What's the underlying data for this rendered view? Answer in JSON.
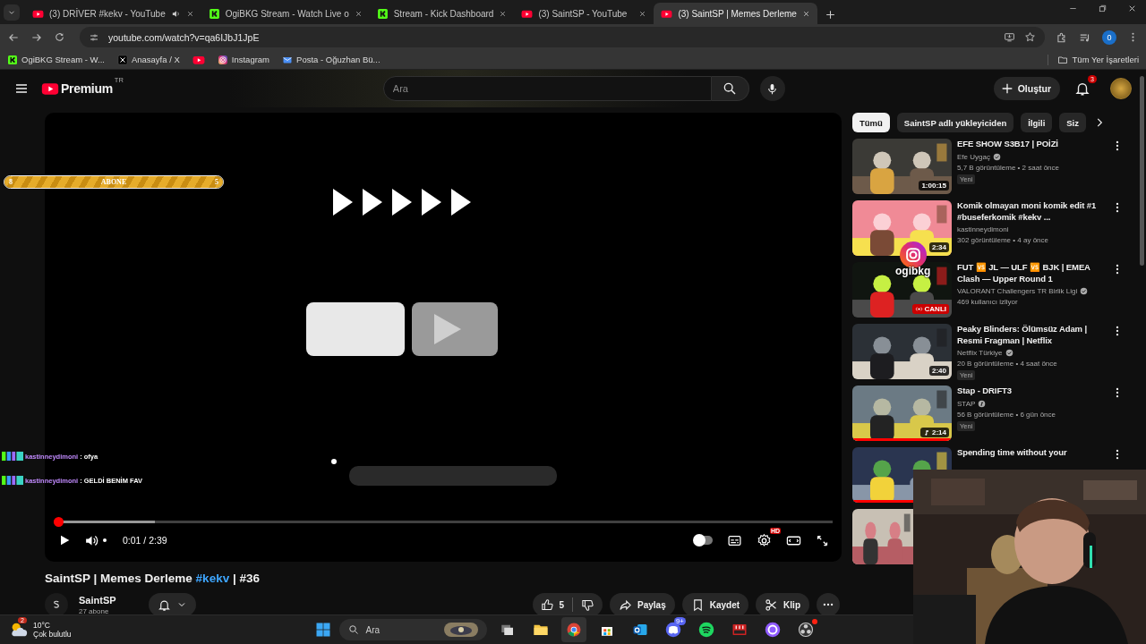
{
  "browser": {
    "tabs": [
      {
        "title": "(3) DRİVER #kekv - YouTube",
        "audio": true,
        "selected": false
      },
      {
        "title": "OgiBKG Stream - Watch Live o",
        "audio": false,
        "selected": false
      },
      {
        "title": "Stream - Kick Dashboard",
        "audio": false,
        "selected": false
      },
      {
        "title": "(3) SaintSP - YouTube",
        "audio": false,
        "selected": false
      },
      {
        "title": "(3) SaintSP | Memes Derleme",
        "audio": false,
        "selected": true
      }
    ],
    "address": "youtube.com/watch?v=qa6IJbJ1JpE",
    "bookmarks": [
      {
        "label": "OgiBKG Stream - W..."
      },
      {
        "label": "Anasayfa / X"
      },
      {
        "kind": "icon"
      },
      {
        "label": "Instagram"
      },
      {
        "label": "Posta - Oğuzhan Bü..."
      }
    ],
    "all_bookmarks": "Tüm Yer İşaretleri",
    "profile": "0"
  },
  "youtube": {
    "logo": "Premium",
    "region": "TR",
    "search_placeholder": "Ara",
    "create": "Oluştur",
    "notifications": "3",
    "player": {
      "time": "0:01 / 2:39",
      "progress": {
        "level": 0.006
      },
      "buffer": {
        "level": 0.13
      },
      "quality_badge": "HD",
      "autoplay": false
    },
    "title_parts": [
      {
        "text": "SaintSP | Memes Derleme ",
        "kind": "plain"
      },
      {
        "text": "#kekv",
        "kind": "hashtag"
      },
      {
        "text": " | #36",
        "kind": "plain"
      }
    ],
    "channel": {
      "name": "SaintSP",
      "subscribers": "27 abone"
    },
    "likes": "5",
    "actions": [
      {
        "label": "Paylaş",
        "kind": "share"
      },
      {
        "label": "Kaydet",
        "kind": "save"
      },
      {
        "label": "Klip",
        "kind": "clip"
      }
    ],
    "chips": [
      {
        "label": "Tümü",
        "selected": true
      },
      {
        "label": "SaintSP adlı yükleyiciden",
        "selected": false
      },
      {
        "label": "İlgili",
        "selected": false
      },
      {
        "label": "Siz",
        "selected": false
      }
    ],
    "recommendations": [
      {
        "title": "EFE SHOW S3B17 | POİZİ",
        "channel": "Efe Uygaç",
        "verified": true,
        "meta": "5,7 B görüntüleme • 2 saat önce",
        "tag": "Yeni",
        "duration": "1:00:15",
        "kind": "video"
      },
      {
        "title": "Komik olmayan moni komik edit #1 #buseferkomik #kekv ...",
        "channel": "kastinneydimoni",
        "verified": false,
        "meta": "302 görüntüleme • 4 ay önce",
        "duration": "2:34",
        "kind": "video"
      },
      {
        "title": "FUT 🆚 JL — ULF 🆚 BJK | EMEA Clash — Upper Round 1",
        "channel": "VALORANT Challengers TR Birlik Ligi",
        "verified": true,
        "meta": "469 kullanıcı izliyor",
        "duration": "CANLI",
        "kind": "live"
      },
      {
        "title": "Peaky Blinders: Ölümsüz Adam | Resmi Fragman | Netflix",
        "channel": "Netflix Türkiye",
        "verified": true,
        "meta": "20 B görüntüleme • 4 saat önce",
        "tag": "Yeni",
        "duration": "2:40",
        "kind": "video"
      },
      {
        "title": "Stap - DRIFT3",
        "channel": "STAP",
        "verified": true,
        "meta": "56 B görüntüleme • 6 gün önce",
        "tag": "Yeni",
        "duration": "2:14",
        "kind": "music",
        "watched": {
          "level": 1
        }
      },
      {
        "title": "Spending time without your",
        "watched": {
          "level": 1
        }
      },
      {
        "kind": "thumbnail"
      }
    ]
  },
  "overlay": {
    "goal": {
      "label": "ABONE",
      "start": "8",
      "end": "5",
      "level": 1
    },
    "chat": [
      {
        "user": "kastinneydimoni",
        "message": ": ofya"
      },
      {
        "user": "kastinneydimoni",
        "message": ": GELDİ BENİM FAV"
      }
    ],
    "social": {
      "handle": "ogibkg"
    }
  },
  "taskbar": {
    "weather": {
      "temperature": "10°C",
      "condition": "Çok bulutlu",
      "badge": "2"
    },
    "search_placeholder": "Ara",
    "apps": [
      {
        "kind": "taskview",
        "active": false,
        "alert": false
      },
      {
        "kind": "explorer",
        "active": false,
        "alert": false
      },
      {
        "kind": "browser",
        "active": true,
        "alert": false
      },
      {
        "kind": "store",
        "active": false,
        "alert": false
      },
      {
        "kind": "mail",
        "active": false,
        "alert": false
      },
      {
        "kind": "chat",
        "active": false,
        "alert": false,
        "badge": "9+"
      },
      {
        "kind": "music",
        "active": false,
        "alert": false
      },
      {
        "kind": "mixer",
        "active": false,
        "alert": false
      },
      {
        "kind": "circle",
        "active": false,
        "alert": false
      },
      {
        "kind": "recorder",
        "active": false,
        "alert": true
      }
    ]
  }
}
